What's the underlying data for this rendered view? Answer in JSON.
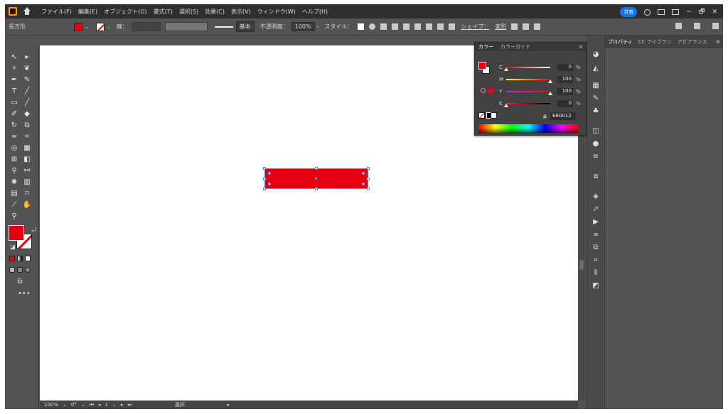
{
  "menubar": {
    "app_icon": "ai-logo-icon",
    "items": [
      "ファイル(F)",
      "編集(E)",
      "オブジェクト(O)",
      "書式(T)",
      "選択(S)",
      "効果(C)",
      "表示(V)",
      "ウィンドウ(W)",
      "ヘルプ(H)"
    ],
    "share_label": "共有",
    "window_controls": [
      "−",
      "🗗",
      "✕"
    ]
  },
  "control_bar": {
    "object_label": "長方形",
    "stroke_label": "線：",
    "stroke_style_label": "基本",
    "opacity_label": "不透明度：",
    "opacity_value": "100%",
    "style_label": "スタイル：",
    "shape_label": "シェイプ：",
    "transform_label": "変形"
  },
  "color_panel": {
    "tabs": [
      "カラー",
      "カラーガイド"
    ],
    "sliders": [
      {
        "label": "C",
        "value": "0",
        "pct": "%",
        "fraction": 0.0,
        "gradient": "linear-gradient(to right,#e60012,#ffffff)"
      },
      {
        "label": "M",
        "value": "100",
        "pct": "%",
        "fraction": 1.0,
        "gradient": "linear-gradient(to right,#ffff00,#ff0000)"
      },
      {
        "label": "Y",
        "value": "100",
        "pct": "%",
        "fraction": 1.0,
        "gradient": "linear-gradient(to right,#ff00ff,#ff0000)"
      },
      {
        "label": "K",
        "value": "0",
        "pct": "%",
        "fraction": 0.0,
        "gradient": "linear-gradient(to right,#ff2020,#000000)"
      }
    ],
    "hex_label": "#",
    "hex_value": "E60012",
    "fill_color": "#e60012"
  },
  "properties_panel": {
    "tabs": [
      "プロパティ",
      "CC ライブラリ",
      "アピアランス"
    ]
  },
  "statusbar": {
    "zoom": "100%",
    "rotation": "0°",
    "artboard": "1",
    "tool_name": "選択"
  },
  "canvas": {
    "object_color": "#e60012"
  }
}
